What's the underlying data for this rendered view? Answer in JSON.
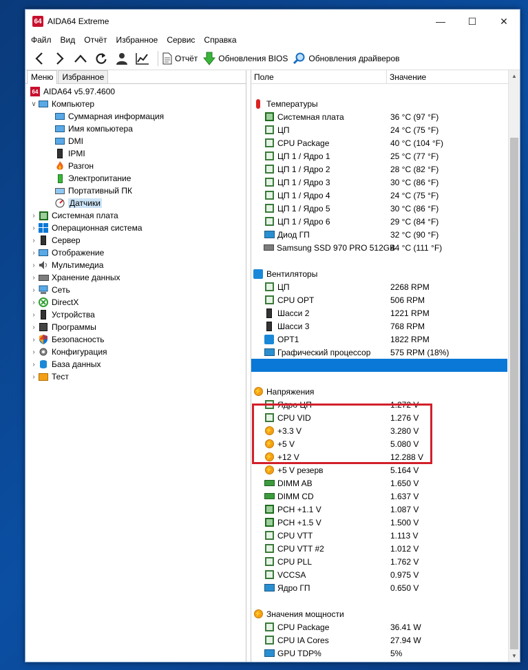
{
  "window": {
    "app_icon": "64",
    "title": "AIDA64 Extreme",
    "minimize_icon": "minimize-icon",
    "maximize_icon": "maximize-icon",
    "close_icon": "close-icon"
  },
  "menu": [
    "Файл",
    "Вид",
    "Отчёт",
    "Избранное",
    "Сервис",
    "Справка"
  ],
  "toolbar": {
    "buttons": [
      "back-icon",
      "forward-icon",
      "up-icon",
      "refresh-icon",
      "user-icon",
      "chart-icon"
    ],
    "report_label": "Отчёт",
    "bios_label": "Обновления BIOS",
    "drivers_label": "Обновления драйверов"
  },
  "tabs": {
    "menu": "Меню",
    "favorites": "Избранное"
  },
  "tree": {
    "root": "AIDA64 v5.97.4600",
    "computer": "Компьютер",
    "computer_children": [
      "Суммарная информация",
      "Имя компьютера",
      "DMI",
      "IPMI",
      "Разгон",
      "Электропитание",
      "Портативный ПК",
      "Датчики"
    ],
    "top_items": [
      "Системная плата",
      "Операционная система",
      "Сервер",
      "Отображение",
      "Мультимедиа",
      "Хранение данных",
      "Сеть",
      "DirectX",
      "Устройства",
      "Программы",
      "Безопасность",
      "Конфигурация",
      "База данных",
      "Тест"
    ]
  },
  "columns": {
    "field": "Поле",
    "value": "Значение"
  },
  "sections": [
    {
      "title": "Температуры",
      "icon": "thermometer-icon",
      "rows": [
        {
          "field": "Системная плата",
          "value": "36 °C  (97 °F)",
          "icon": "motherboard-icon"
        },
        {
          "field": "ЦП",
          "value": "24 °C  (75 °F)",
          "icon": "cpu-icon"
        },
        {
          "field": "CPU Package",
          "value": "40 °C  (104 °F)",
          "icon": "cpu-icon"
        },
        {
          "field": "ЦП 1 / Ядро 1",
          "value": "25 °C  (77 °F)",
          "icon": "cpu-icon"
        },
        {
          "field": "ЦП 1 / Ядро 2",
          "value": "28 °C  (82 °F)",
          "icon": "cpu-icon"
        },
        {
          "field": "ЦП 1 / Ядро 3",
          "value": "30 °C  (86 °F)",
          "icon": "cpu-icon"
        },
        {
          "field": "ЦП 1 / Ядро 4",
          "value": "24 °C  (75 °F)",
          "icon": "cpu-icon"
        },
        {
          "field": "ЦП 1 / Ядро 5",
          "value": "30 °C  (86 °F)",
          "icon": "cpu-icon"
        },
        {
          "field": "ЦП 1 / Ядро 6",
          "value": "29 °C  (84 °F)",
          "icon": "cpu-icon"
        },
        {
          "field": "Диод ГП",
          "value": "32 °C  (90 °F)",
          "icon": "gpu-icon"
        },
        {
          "field": "Samsung SSD 970 PRO 512GB",
          "value": "44 °C  (111 °F)",
          "icon": "drive-icon"
        }
      ]
    },
    {
      "title": "Вентиляторы",
      "icon": "fan-icon",
      "rows": [
        {
          "field": "ЦП",
          "value": "2268 RPM",
          "icon": "cpu-icon"
        },
        {
          "field": "CPU OPT",
          "value": "506 RPM",
          "icon": "cpu-icon"
        },
        {
          "field": "Шасси 2",
          "value": "1221 RPM",
          "icon": "chassis-icon"
        },
        {
          "field": "Шасси 3",
          "value": "768 RPM",
          "icon": "chassis-icon"
        },
        {
          "field": "OPT1",
          "value": "1822 RPM",
          "icon": "fan-icon"
        },
        {
          "field": "Графический процессор",
          "value": "575 RPM  (18%)",
          "icon": "gpu-icon"
        }
      ]
    },
    {
      "title": "Напряжения",
      "icon": "voltage-icon",
      "rows": [
        {
          "field": "Ядро ЦП",
          "value": "1.272 V",
          "icon": "cpu-icon"
        },
        {
          "field": "CPU VID",
          "value": "1.276 V",
          "icon": "cpu-icon"
        },
        {
          "field": "+3.3 V",
          "value": "3.280 V",
          "icon": "voltage-icon"
        },
        {
          "field": "+5 V",
          "value": "5.080 V",
          "icon": "voltage-icon"
        },
        {
          "field": "+12 V",
          "value": "12.288 V",
          "icon": "voltage-icon"
        },
        {
          "field": "+5 V резерв",
          "value": "5.164 V",
          "icon": "voltage-icon"
        },
        {
          "field": "DIMM AB",
          "value": "1.650 V",
          "icon": "ram-icon"
        },
        {
          "field": "DIMM CD",
          "value": "1.637 V",
          "icon": "ram-icon"
        },
        {
          "field": "PCH +1.1 V",
          "value": "1.087 V",
          "icon": "chip-icon"
        },
        {
          "field": "PCH +1.5 V",
          "value": "1.500 V",
          "icon": "chip-icon"
        },
        {
          "field": "CPU VTT",
          "value": "1.113 V",
          "icon": "cpu-icon"
        },
        {
          "field": "CPU VTT #2",
          "value": "1.012 V",
          "icon": "cpu-icon"
        },
        {
          "field": "CPU PLL",
          "value": "1.762 V",
          "icon": "cpu-icon"
        },
        {
          "field": "VCCSA",
          "value": "0.975 V",
          "icon": "cpu-icon"
        },
        {
          "field": "Ядро ГП",
          "value": "0.650 V",
          "icon": "gpu-icon"
        }
      ]
    },
    {
      "title": "Значения мощности",
      "icon": "voltage-icon",
      "rows": [
        {
          "field": "CPU Package",
          "value": "36.41 W",
          "icon": "cpu-icon"
        },
        {
          "field": "CPU IA Cores",
          "value": "27.94 W",
          "icon": "cpu-icon"
        },
        {
          "field": "GPU TDP%",
          "value": "5%",
          "icon": "gpu-icon"
        }
      ]
    }
  ]
}
